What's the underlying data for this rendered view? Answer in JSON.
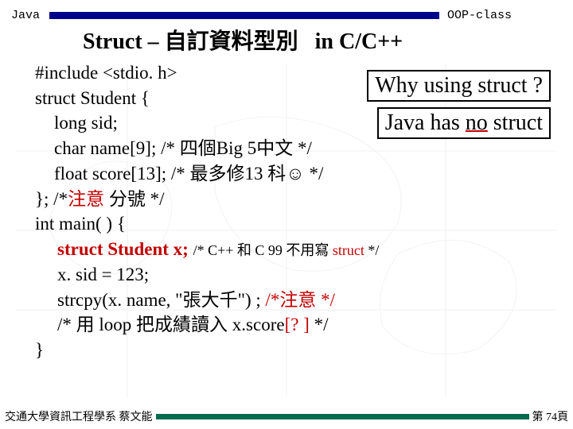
{
  "header": {
    "left_label": "Java",
    "right_label": "OOP-class",
    "title_a": "Struct – 自訂資料型別",
    "title_b": "in C/C++"
  },
  "callouts": {
    "why": "Why using struct ?",
    "java_has": "Java has ",
    "no": "no",
    "struct": " struct"
  },
  "code": {
    "l1": "#include <stdio. h>",
    "l2": "struct Student {",
    "l3": "long  sid;",
    "l4a": "char name[9];   /* 四個Big 5中文 */",
    "l5a": "float score[13];   /* 最多修13 科",
    "l5b": " */",
    "l6a": "};      /*",
    "l6b": "注意",
    "l6c": "  分號",
    "l6d": " */",
    "l7": "int main( ) {",
    "l8a": "struct Student x;",
    "l8b": "/* C++ 和 C 99 不用寫 ",
    "l8c": "struct",
    "l8d": " */",
    "l9": "x. sid = 123;",
    "l10a": "strcpy(x. name, \"張大千\") ;  ",
    "l10b": "/*注意 */",
    "l11a": "/* 用 loop 把成績讀入 x.score",
    "l11b": "[? ]",
    "l11c": " */",
    "l12": "}"
  },
  "footer": {
    "left": "交通大學資訊工程學系  蔡文能",
    "right": "第 74頁"
  }
}
